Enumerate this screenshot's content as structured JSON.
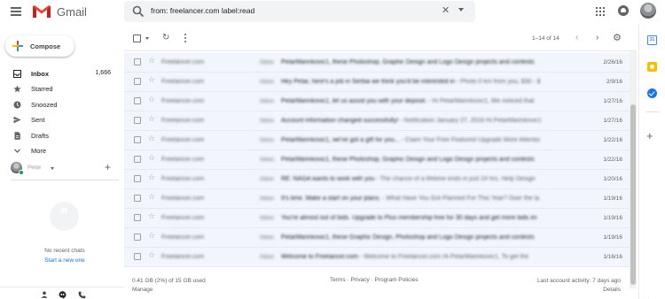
{
  "header": {
    "logo_text": "Gmail",
    "search_query": "from: freelancer.com label:read",
    "icons": [
      "menu-icon",
      "gmail-logo-icon",
      "search-icon",
      "clear-search-icon",
      "search-options-icon",
      "apps-icon",
      "notifications-icon",
      "account-avatar"
    ]
  },
  "sidebar": {
    "compose_label": "Compose",
    "items": [
      {
        "label": "Inbox",
        "count": "1,666",
        "icon": "inbox-icon",
        "active": true
      },
      {
        "label": "Starred",
        "count": "",
        "icon": "star-icon"
      },
      {
        "label": "Snoozed",
        "count": "",
        "icon": "clock-icon"
      },
      {
        "label": "Sent",
        "count": "",
        "icon": "send-icon"
      },
      {
        "label": "Drafts",
        "count": "",
        "icon": "draft-icon"
      },
      {
        "label": "More",
        "count": "",
        "icon": "chevron-down-icon"
      }
    ],
    "hangouts": {
      "user_name": "Petar",
      "no_chats_text": "No recent chats",
      "new_chat_link": "Start a new one"
    }
  },
  "toolbar": {
    "page_count": "1–14 of 14"
  },
  "emails": [
    {
      "sender": "Freelancer.com",
      "tag": "Inbox",
      "subject": "PetarMarinkovic1, these Photoshop, Graphic Design and Logo Design projects and contests",
      "snippet": "",
      "date": "2/26/16"
    },
    {
      "sender": "Freelancer.com",
      "tag": "Inbox",
      "subject": "Hey Petar, here's a job in Serbia we think you'd be interested in",
      "snippet": " - Photo 0 km from you, $30 - $",
      "date": "2/9/16"
    },
    {
      "sender": "Freelancer.com",
      "tag": "Inbox",
      "subject": "PetarMarinkovic1, let us assist you with your deposit.",
      "snippet": " - Hi PetarMarinkovic1, We noticed that",
      "date": "1/27/16"
    },
    {
      "sender": "Freelancer.com",
      "tag": "Inbox",
      "subject": "Account information changed successfully!",
      "snippet": " - Notification January 27, 2016 Hi PetarMarinkovic1",
      "date": "1/27/16"
    },
    {
      "sender": "Freelancer.com",
      "tag": "Inbox",
      "subject": "PetarMarinkovic1, we've got a gift for you...",
      "snippet": " - Claim Your Free Featured Upgrade More Attentio",
      "date": "1/22/16"
    },
    {
      "sender": "Freelancer.com",
      "tag": "Inbox",
      "subject": "PetarMarinkovic1, these Photoshop, Graphic Design and Logo Design projects and contests",
      "snippet": "",
      "date": "1/22/16"
    },
    {
      "sender": "Freelancer.com",
      "tag": "Inbox",
      "subject": "RE: NAGA wants to work with you",
      "snippet": " - The chance of a lifetime ends in just 24 hrs. Help Design",
      "date": "1/20/16"
    },
    {
      "sender": "Freelancer.com",
      "tag": "Inbox",
      "subject": "It's time. Make a start on your plans.",
      "snippet": " - What Have You Got Planned For This Year? Over the la",
      "date": "1/19/16"
    },
    {
      "sender": "Freelancer.com",
      "tag": "Inbox",
      "subject": "You're almost out of bids. Upgrade to Plus membership free for 30 days and get more bids im",
      "snippet": "",
      "date": "1/19/16"
    },
    {
      "sender": "Freelancer.com",
      "tag": "Inbox",
      "subject": "PetarMarinkovic1, these Graphic Design, Photoshop and Logo Design projects and contests",
      "snippet": "",
      "date": "1/19/16"
    },
    {
      "sender": "Freelancer.com",
      "tag": "Inbox",
      "subject": "Welcome to Freelancer.com",
      "snippet": " - Welcome to Freelancer.com Hi PetarMarinkovic1, To get the",
      "date": "1/16/16"
    }
  ],
  "footer": {
    "storage": "0.41 GB (2%) of 15 GB used",
    "manage": "Manage",
    "links": "Terms · Privacy · Program Policies",
    "activity": "Last account activity: 7 days ago",
    "details": "Details"
  },
  "colors": {
    "row_background": "#f2f6fc",
    "link_blue": "#1a73e8",
    "online_green": "#0f9d58"
  }
}
